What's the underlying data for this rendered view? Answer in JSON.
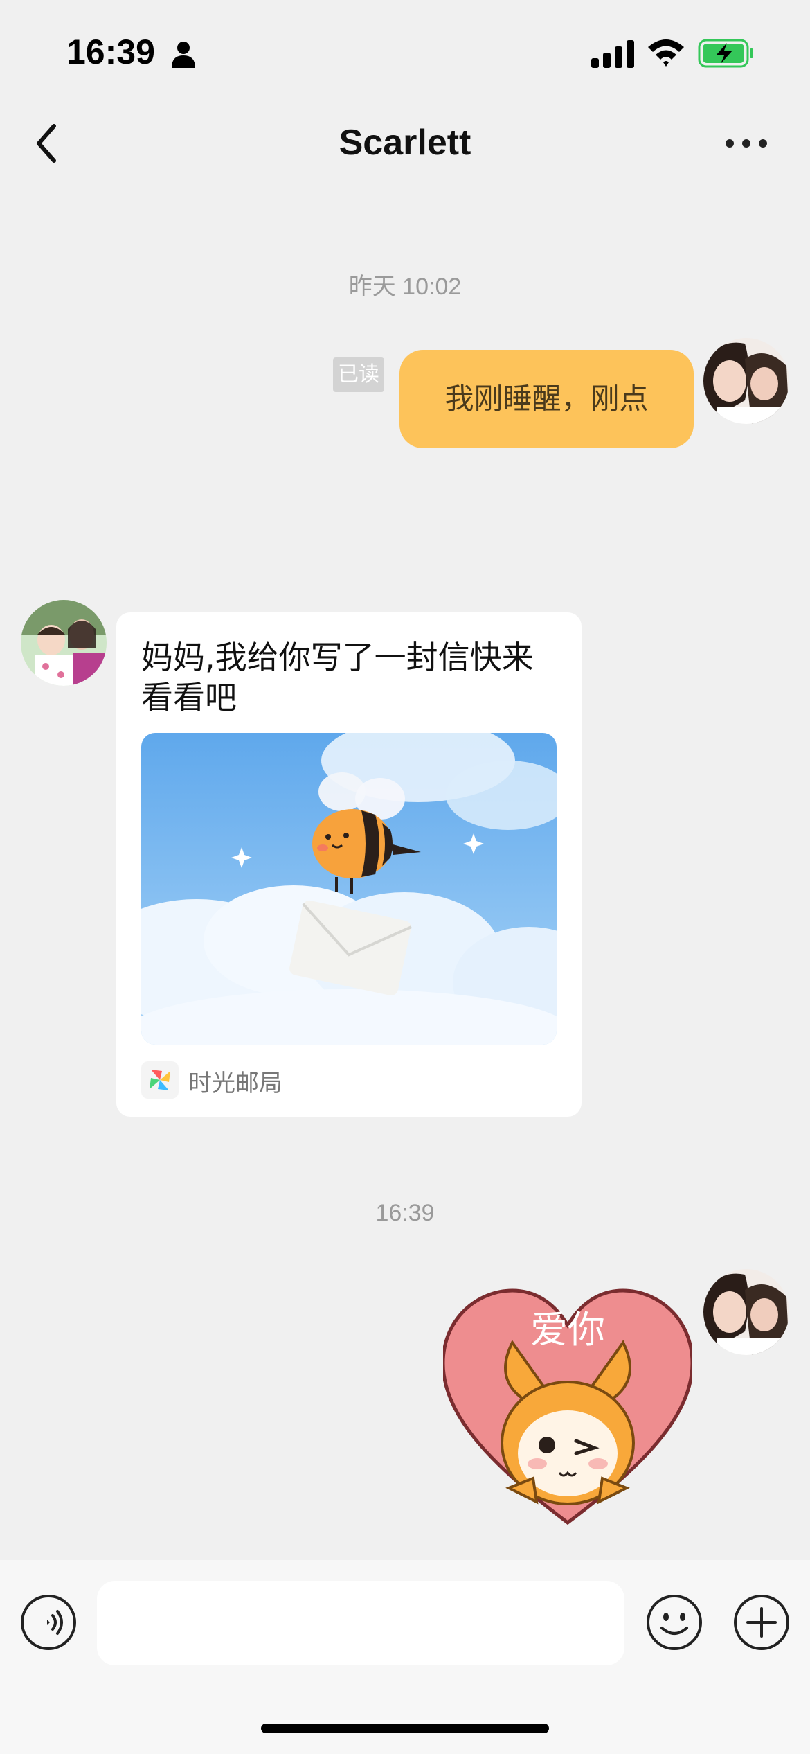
{
  "status_bar": {
    "time": "16:39",
    "icons": [
      "person-icon",
      "signal-icon",
      "wifi-icon",
      "battery-charging-icon"
    ],
    "battery_color": "#34c759"
  },
  "nav": {
    "title": "Scarlett",
    "back_icon": "chevron-left-icon",
    "more_icon": "more-dots-icon"
  },
  "messages": {
    "timestamp_1": "昨天 10:02",
    "read_status": "已读",
    "outgoing_text": "我刚睡醒，刚点",
    "card": {
      "text": "妈妈,我给你写了一封信快来看看吧",
      "app_name": "时光邮局"
    },
    "timestamp_2": "16:39",
    "sticker": {
      "text": "爱你"
    }
  },
  "input_bar": {
    "placeholder": "",
    "icons": [
      "voice-icon",
      "emoji-icon",
      "plus-icon"
    ]
  },
  "colors": {
    "outgoing_bubble": "#fdc35a",
    "background": "#f0f0f0",
    "sticker_heart": "#ee8d8f",
    "sticker_character": "#f8a83a"
  }
}
